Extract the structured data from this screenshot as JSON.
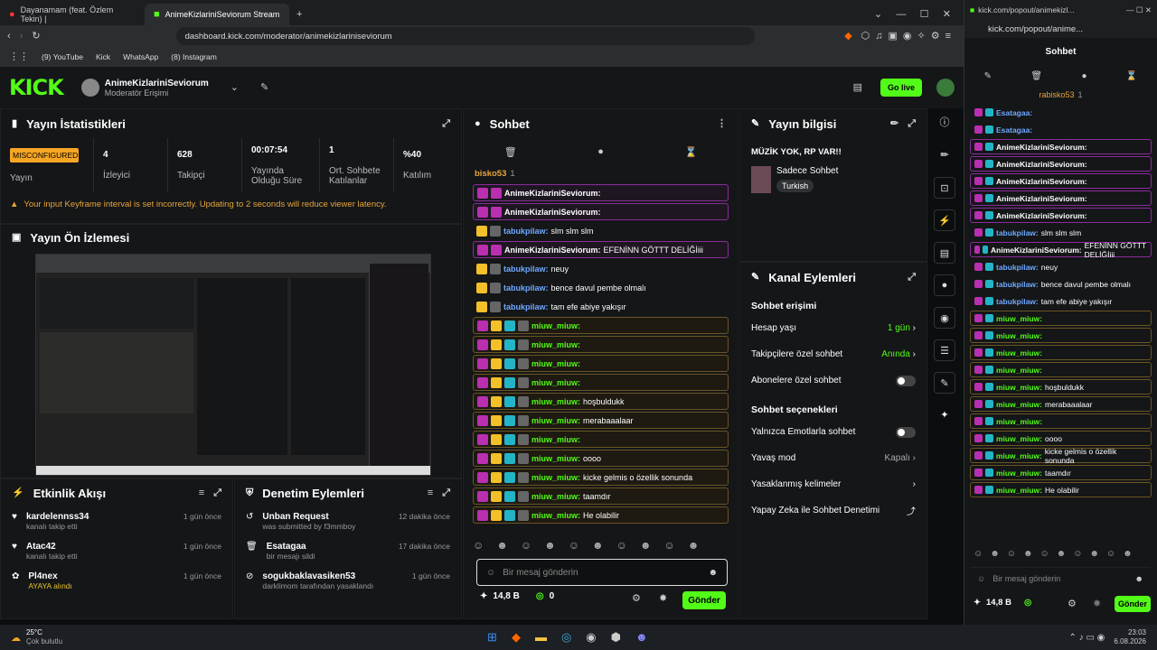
{
  "browser": {
    "tab1": "Dayanamam (feat. Özlem Tekin) |",
    "tab2": "AnimeKizlariniSeviorum Stream",
    "url": "dashboard.kick.com/moderator/animekizlariniseviorum",
    "bookmarks": [
      "(9) YouTube",
      "Kick",
      "WhatsApp",
      "(8) Instagram"
    ]
  },
  "header": {
    "channel": "AnimeKizlariniSeviorum",
    "role": "Moderatör Erişimi",
    "go_live": "Go live"
  },
  "stats": {
    "title": "Yayın İstatistikleri",
    "status": "MISCONFIGURED",
    "status_label": "Yayın",
    "items": [
      {
        "v": "4",
        "l": "İzleyici"
      },
      {
        "v": "628",
        "l": "Takipçi"
      },
      {
        "v": "00:07:54",
        "l": "Yayında Olduğu Süre"
      },
      {
        "v": "1",
        "l": "Ort. Sohbete Katılanlar"
      },
      {
        "v": "%40",
        "l": "Katılım"
      }
    ],
    "warning": "Your input Keyframe interval is set incorrectly. Updating to 2 seconds will reduce viewer latency."
  },
  "preview": {
    "title": "Yayın Ön İzlemesi"
  },
  "activity": {
    "title": "Etkinlik Akışı",
    "items": [
      {
        "t": "kardelennss34",
        "s": "kanalı takip etti",
        "tm": "1 gün önce"
      },
      {
        "t": "Atac42",
        "s": "kanalı takip etti",
        "tm": "1 gün önce"
      },
      {
        "t": "Pl4nex",
        "s": "AYAYA alındı",
        "tm": "1 gün önce"
      }
    ]
  },
  "moderation": {
    "title": "Denetim Eylemleri",
    "items": [
      {
        "t": "Unban Request",
        "s": "was submitted by f3mmboy",
        "tm": "12 dakika önce"
      },
      {
        "t": "Esatagaa",
        "s": "bir mesajı sildi",
        "tm": "17 dakika önce"
      },
      {
        "t": "sogukbaklavasiken53",
        "s": "darklimom tarafından yasaklandı",
        "tm": "1 gün önce"
      }
    ]
  },
  "chat": {
    "title": "Sohbet",
    "pinned": "bisko53",
    "pinned_count": "1",
    "input_placeholder": "Bir mesaj gönderin",
    "send": "Gönder",
    "kicks": "14,8 B",
    "count": "0",
    "messages": [
      {
        "u": "AnimeKizlariniSeviorum:",
        "m": "",
        "c": "#fff",
        "k": "hl"
      },
      {
        "u": "AnimeKizlariniSeviorum:",
        "m": "",
        "c": "#fff",
        "k": "hl"
      },
      {
        "u": "tabukpilaw:",
        "m": "slm slm slm",
        "c": "#6fa8ff",
        "k": ""
      },
      {
        "u": "AnimeKizlariniSeviorum:",
        "m": "EFENİNN GÖTTT DELİĞİiii",
        "c": "#fff",
        "k": "hl"
      },
      {
        "u": "tabukpilaw:",
        "m": "neuy",
        "c": "#6fa8ff",
        "k": ""
      },
      {
        "u": "tabukpilaw:",
        "m": "bence davul pembe olmalı",
        "c": "#6fa8ff",
        "k": ""
      },
      {
        "u": "tabukpilaw:",
        "m": "tam efe abiye yakışır",
        "c": "#6fa8ff",
        "k": ""
      },
      {
        "u": "miuw_miuw:",
        "m": "",
        "c": "#53fc18",
        "k": "sub"
      },
      {
        "u": "miuw_miuw:",
        "m": "",
        "c": "#53fc18",
        "k": "sub"
      },
      {
        "u": "miuw_miuw:",
        "m": "",
        "c": "#53fc18",
        "k": "sub"
      },
      {
        "u": "miuw_miuw:",
        "m": "",
        "c": "#53fc18",
        "k": "sub"
      },
      {
        "u": "miuw_miuw:",
        "m": "hoşbuldukk",
        "c": "#53fc18",
        "k": "sub"
      },
      {
        "u": "miuw_miuw:",
        "m": "merabaaalaar",
        "c": "#53fc18",
        "k": "sub"
      },
      {
        "u": "miuw_miuw:",
        "m": "",
        "c": "#53fc18",
        "k": "sub"
      },
      {
        "u": "miuw_miuw:",
        "m": "oooo",
        "c": "#53fc18",
        "k": "sub"
      },
      {
        "u": "miuw_miuw:",
        "m": "kicke gelmis o özellik sonunda",
        "c": "#53fc18",
        "k": "sub"
      },
      {
        "u": "miuw_miuw:",
        "m": "taamdır",
        "c": "#53fc18",
        "k": "sub"
      },
      {
        "u": "miuw_miuw:",
        "m": "He olabilir",
        "c": "#53fc18",
        "k": "sub"
      }
    ]
  },
  "info": {
    "title": "Yayın bilgisi",
    "stream_title": "MÜZİK YOK, RP VAR!!",
    "category": "Sadece Sohbet",
    "lang": "Turkish"
  },
  "channel_actions": {
    "title": "Kanal Eylemleri",
    "access": "Sohbet erişimi",
    "account_age": "Hesap yaşı",
    "account_age_v": "1 gün",
    "followers_only": "Takipçilere özel sohbet",
    "followers_only_v": "Anında",
    "subs_only": "Abonelere özel sohbet",
    "options": "Sohbet seçenekleri",
    "emote_only": "Yalnızca Emotlarla sohbet",
    "slow": "Yavaş mod",
    "slow_v": "Kapalı",
    "banned_words": "Yasaklanmış kelimeler",
    "ai_mod": "Yapay Zeka ile Sohbet Denetimi"
  },
  "popout": {
    "url": "kick.com/popout/animekizl...",
    "url2": "kick.com/popout/anime...",
    "title": "Sohbet",
    "pinned": "rabisko53",
    "pinned_count": "1",
    "placeholder": "Bir mesaj gönderin",
    "send": "Gönder",
    "kicks": "14,8 B",
    "messages": [
      {
        "u": "Esatagaa:",
        "m": "",
        "c": "#6fa8ff"
      },
      {
        "u": "Esatagaa:",
        "m": "",
        "c": "#6fa8ff"
      },
      {
        "u": "AnimeKizlariniSeviorum:",
        "m": "",
        "c": "#fff"
      },
      {
        "u": "AnimeKizlariniSeviorum:",
        "m": "",
        "c": "#fff"
      },
      {
        "u": "AnimeKizlariniSeviorum:",
        "m": "",
        "c": "#fff"
      },
      {
        "u": "AnimeKizlariniSeviorum:",
        "m": "",
        "c": "#fff"
      },
      {
        "u": "AnimeKizlariniSeviorum:",
        "m": "",
        "c": "#fff"
      },
      {
        "u": "tabukpilaw:",
        "m": "slm slm slm",
        "c": "#6fa8ff"
      },
      {
        "u": "AnimeKizlariniSeviorum:",
        "m": "EFENİNN GÖTTT DELİĞİiii",
        "c": "#fff"
      },
      {
        "u": "tabukpilaw:",
        "m": "neuy",
        "c": "#6fa8ff"
      },
      {
        "u": "tabukpilaw:",
        "m": "bence davul pembe olmalı",
        "c": "#6fa8ff"
      },
      {
        "u": "tabukpilaw:",
        "m": "tam efe abiye yakışır",
        "c": "#6fa8ff"
      },
      {
        "u": "miuw_miuw:",
        "m": "",
        "c": "#53fc18"
      },
      {
        "u": "miuw_miuw:",
        "m": "",
        "c": "#53fc18"
      },
      {
        "u": "miuw_miuw:",
        "m": "",
        "c": "#53fc18"
      },
      {
        "u": "miuw_miuw:",
        "m": "",
        "c": "#53fc18"
      },
      {
        "u": "miuw_miuw:",
        "m": "hoşbuldukk",
        "c": "#53fc18"
      },
      {
        "u": "miuw_miuw:",
        "m": "merabaaalaar",
        "c": "#53fc18"
      },
      {
        "u": "miuw_miuw:",
        "m": "",
        "c": "#53fc18"
      },
      {
        "u": "miuw_miuw:",
        "m": "oooo",
        "c": "#53fc18"
      },
      {
        "u": "miuw_miuw:",
        "m": "kicke gelmis o özellik sonunda",
        "c": "#53fc18"
      },
      {
        "u": "miuw_miuw:",
        "m": "taamdır",
        "c": "#53fc18"
      },
      {
        "u": "miuw_miuw:",
        "m": "He olabilir",
        "c": "#53fc18"
      }
    ]
  },
  "taskbar": {
    "temp": "25°C",
    "weather": "Çok bulutlu",
    "time": "23:03",
    "date": "6.08.2026"
  }
}
